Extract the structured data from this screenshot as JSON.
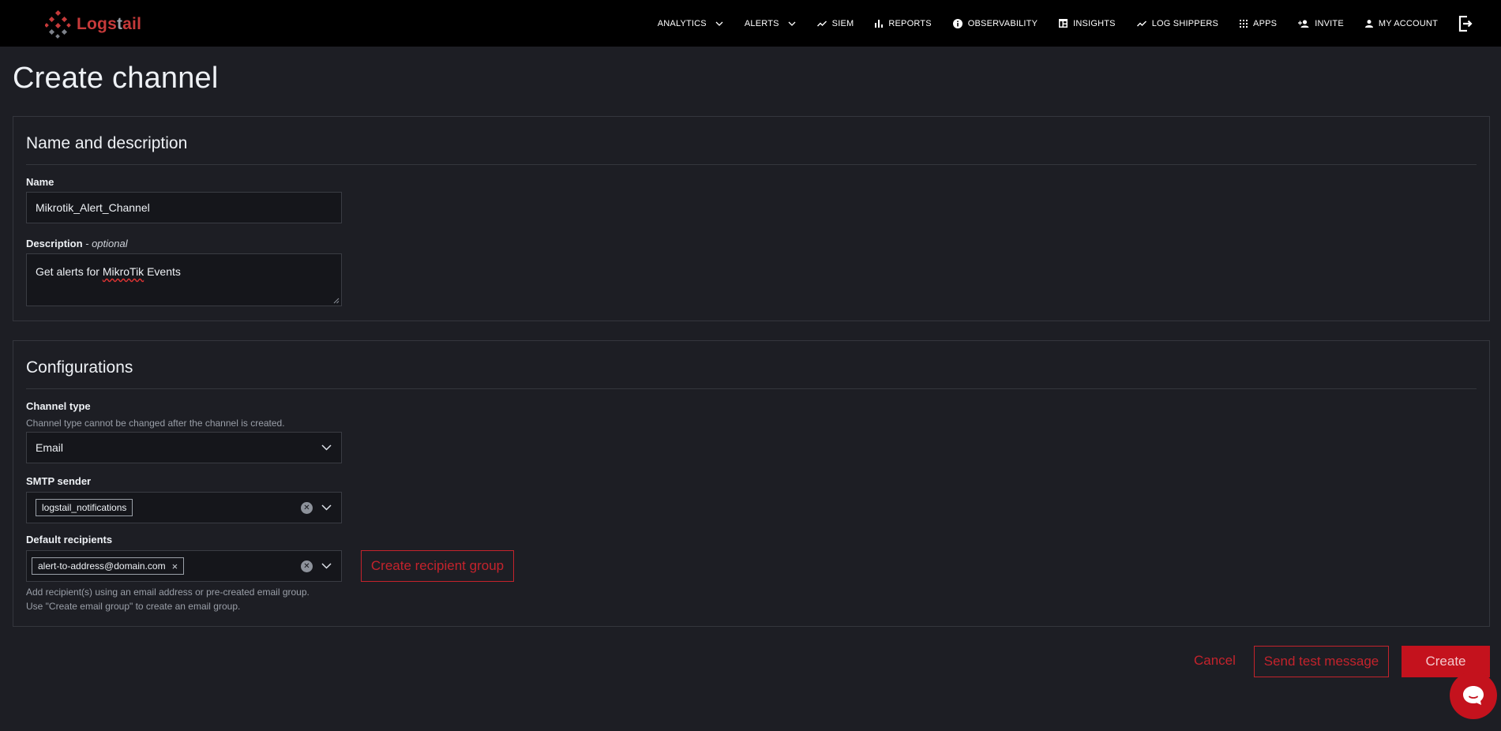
{
  "header": {
    "logo_part1": "Logs",
    "logo_part2": "t",
    "logo_part3": "ail",
    "nav": [
      {
        "label": "ANALYTICS",
        "icon": "chevron-down-icon"
      },
      {
        "label": "ALERTS",
        "icon": "chevron-down-icon"
      },
      {
        "label": "SIEM",
        "icon": "trend-line-icon"
      },
      {
        "label": "REPORTS",
        "icon": "bar-chart-icon"
      },
      {
        "label": "OBSERVABILITY",
        "icon": "info-circle-icon"
      },
      {
        "label": "INSIGHTS",
        "icon": "dashboard-icon"
      },
      {
        "label": "LOG SHIPPERS",
        "icon": "trend-line-icon"
      },
      {
        "label": "APPS",
        "icon": "grid-icon"
      },
      {
        "label": "INVITE",
        "icon": "add-person-icon"
      },
      {
        "label": "MY ACCOUNT",
        "icon": "person-icon"
      }
    ],
    "logout_icon": "logout-icon"
  },
  "page": {
    "title": "Create channel"
  },
  "name_section": {
    "heading": "Name and description",
    "name_label": "Name",
    "name_value": "Mikrotik_Alert_Channel",
    "description_label": "Description",
    "description_optional": " - optional",
    "description_value_1": "Get alerts for ",
    "description_value_2": "MikroTik",
    "description_value_3": " Events"
  },
  "config_section": {
    "heading": "Configurations",
    "channel_type_label": "Channel type",
    "channel_type_help": "Channel type cannot be changed after the channel is created.",
    "channel_type_value": "Email",
    "smtp_label": "SMTP sender",
    "smtp_value": "logstail_notifications",
    "recipients_label": "Default recipients",
    "recipient_value": "alert-to-address@domain.com",
    "recipient_remove": "×",
    "recipients_help_1": "Add recipient(s) using an email address or pre-created email group.",
    "recipients_help_2": "Use \"Create email group\" to create an email group.",
    "create_group_button": "Create recipient group"
  },
  "footer": {
    "cancel": "Cancel",
    "send_test": "Send test message",
    "create": "Create"
  },
  "colors": {
    "accent": "#c4121d",
    "background": "#1d1e24",
    "topbar": "#000000"
  }
}
